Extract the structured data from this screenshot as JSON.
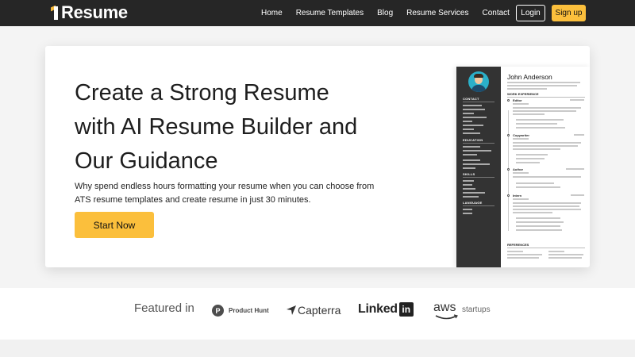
{
  "nav": {
    "logo_digit": "1",
    "logo_word": "Resume",
    "links": [
      "Home",
      "Resume Templates",
      "Blog",
      "Resume Services",
      "Contact"
    ],
    "login": "Login",
    "signup": "Sign up"
  },
  "hero": {
    "headline_lines": [
      "Create a Strong Resume",
      "with AI Resume Builder and",
      "Our Guidance"
    ],
    "subtext_lines": [
      "Why spend endless hours formatting your resume when you can choose from",
      "ATS resume templates and create resume in just 30 minutes."
    ],
    "cta": "Start Now"
  },
  "resume_preview": {
    "name": "John Anderson",
    "side_headings": [
      "CONTACT",
      "EDUCATION",
      "SKILLS",
      "LANGUAGE"
    ],
    "main_headings": [
      "WORK EXPERIENCE",
      "REFERENCES"
    ],
    "jobs": [
      "Editor",
      "Copywriter",
      "Author",
      "Intern"
    ]
  },
  "featured": {
    "label": "Featured in",
    "logos": {
      "product_hunt_letter": "P",
      "product_hunt": "Product Hunt",
      "capterra": "Capterra",
      "linkedin_word": "Linked",
      "linkedin_box": "in",
      "aws": "aws",
      "aws_startups": "startups"
    }
  },
  "colors": {
    "accent": "#fbbf3c",
    "nav_bg": "#262626",
    "resume_sidebar": "#333333"
  }
}
